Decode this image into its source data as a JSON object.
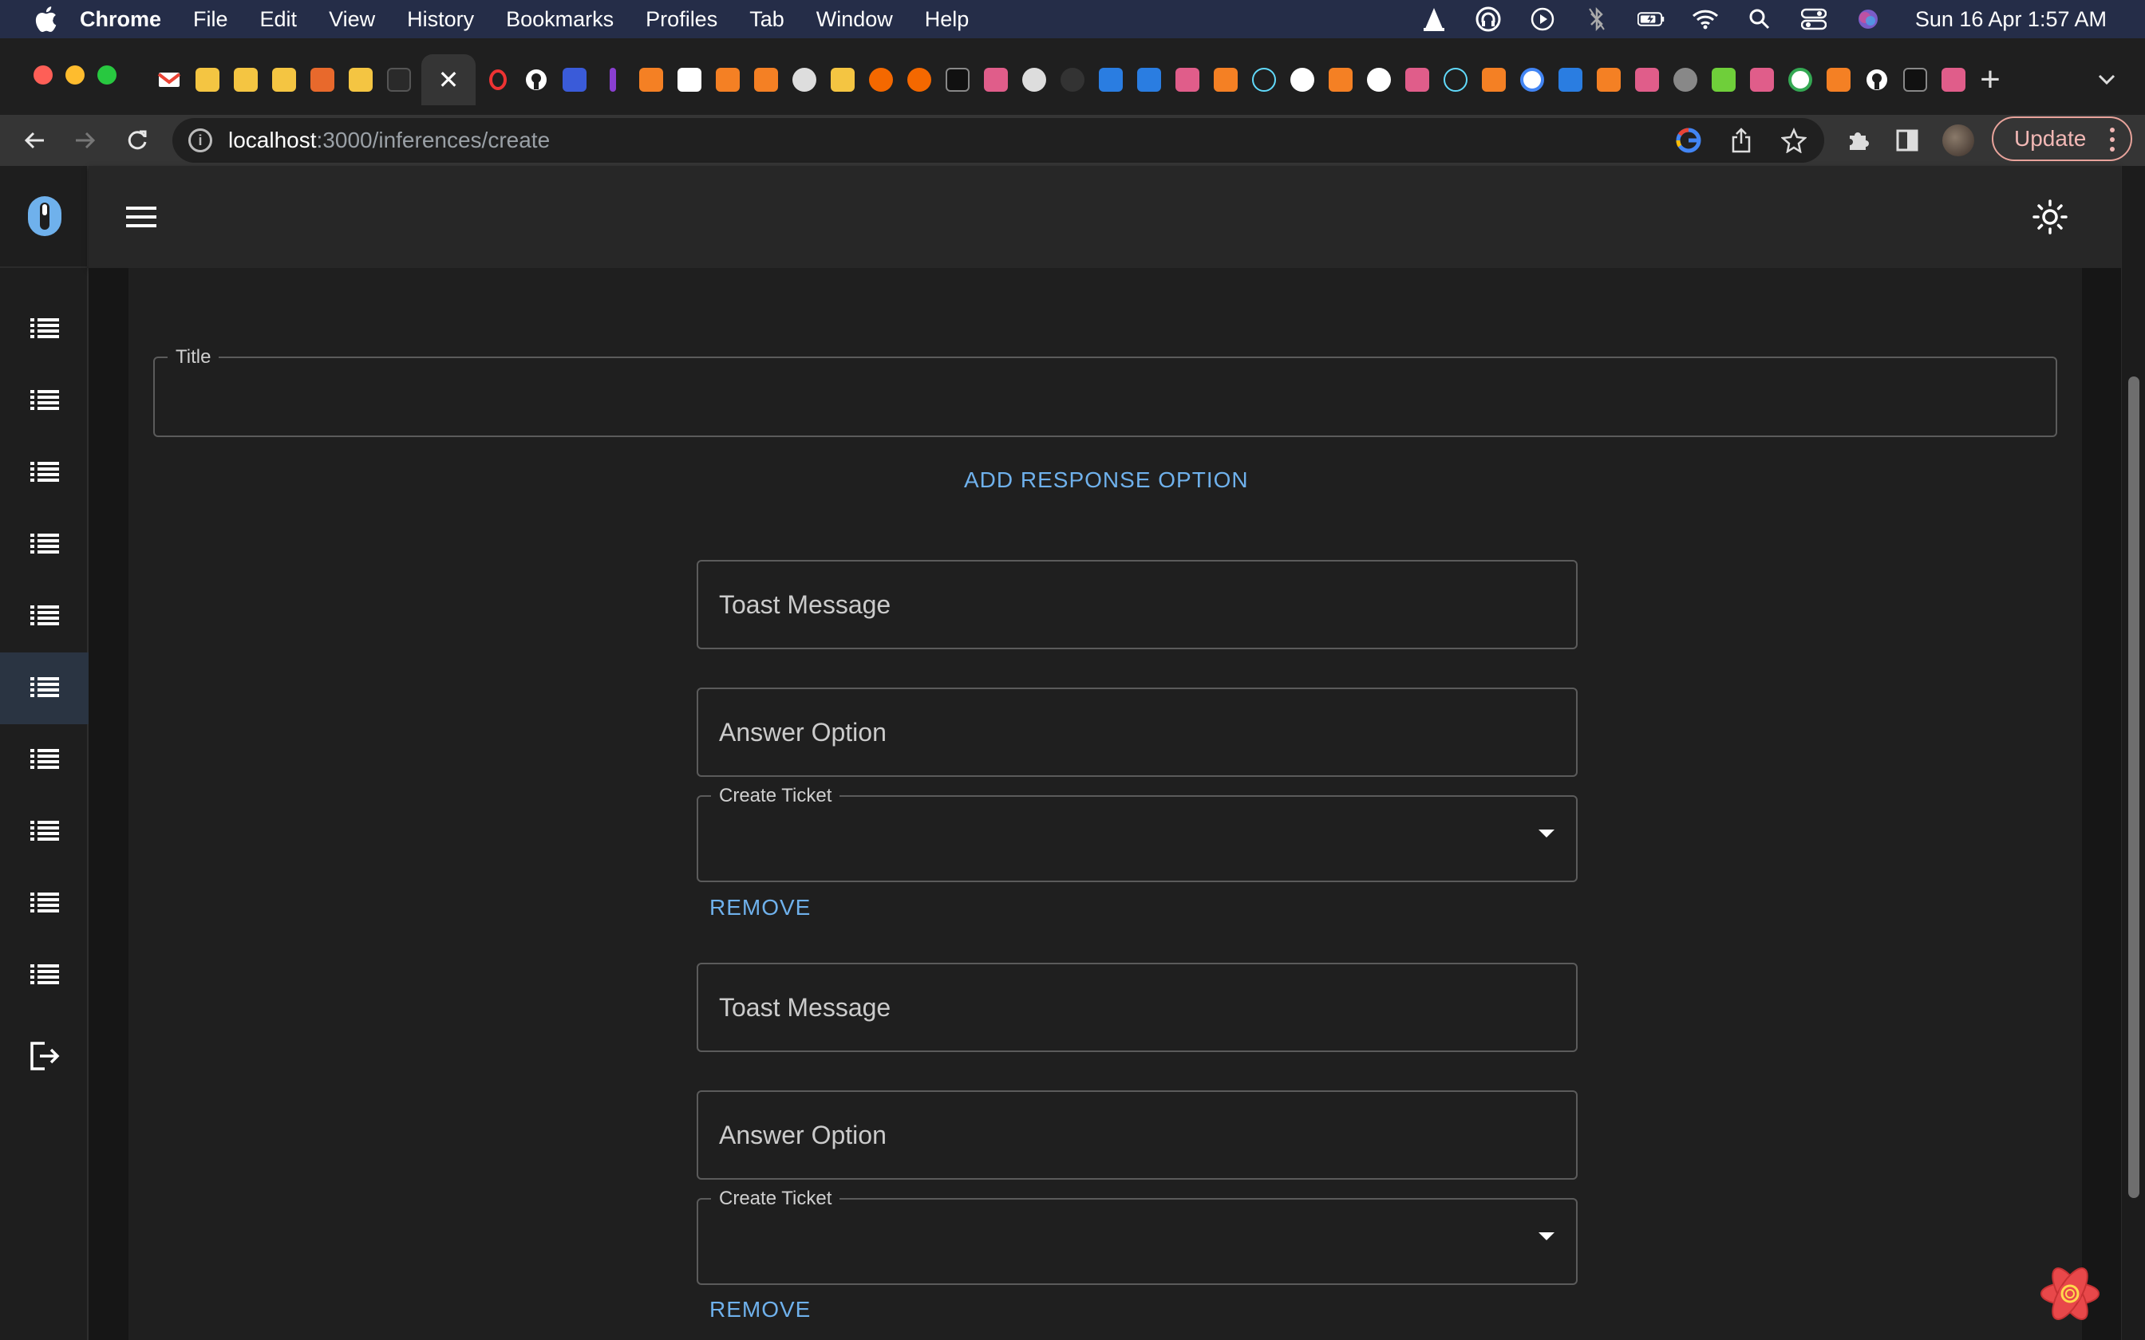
{
  "menubar": {
    "app": "Chrome",
    "items": [
      "File",
      "Edit",
      "View",
      "History",
      "Bookmarks",
      "Profiles",
      "Tab",
      "Window",
      "Help"
    ],
    "clock": "Sun 16 Apr  1:57 AM"
  },
  "browser": {
    "url_host": "localhost",
    "url_path": ":3000/inferences/create",
    "update_label": "Update",
    "tab_close": "✕",
    "new_tab": "+"
  },
  "sidebar": {
    "items": [
      "list-icon",
      "list-icon",
      "list-icon",
      "list-icon",
      "list-icon",
      "list-icon",
      "list-icon",
      "list-icon",
      "list-icon",
      "list-icon",
      "logout-icon"
    ],
    "active_index": 5
  },
  "form": {
    "title_label": "Title",
    "title_value": "",
    "add_response_label": "ADD RESPONSE OPTION",
    "responses": [
      {
        "toast_placeholder": "Toast Message",
        "answer_placeholder": "Answer Option",
        "ticket_label": "Create Ticket",
        "ticket_value": "",
        "remove_label": "REMOVE"
      },
      {
        "toast_placeholder": "Toast Message",
        "answer_placeholder": "Answer Option",
        "ticket_label": "Create Ticket",
        "ticket_value": "",
        "remove_label": "REMOVE"
      }
    ]
  },
  "colors": {
    "accent": "#6fb1ec",
    "menubar_bg": "#252d48",
    "sidebar_active": "#2a3442"
  }
}
